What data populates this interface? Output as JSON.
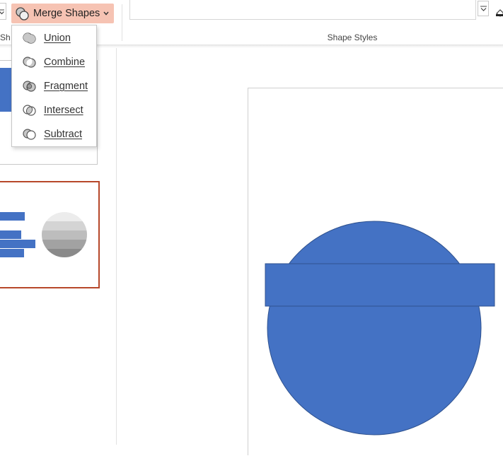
{
  "ribbon": {
    "merge_shapes": {
      "label": "Merge Shapes",
      "icon": "merge-shapes-icon"
    },
    "left_group_label": "Sha",
    "shape_styles_label": "Shape Styles",
    "style_swatches": [
      "#1f1f1f",
      "#4472c4",
      "#ed7d31",
      "#a5a5a5",
      "#ffc000",
      "#5b9bd5",
      "#70ad47"
    ]
  },
  "merge_menu": {
    "items": [
      {
        "label": "Union",
        "icon": "union-icon"
      },
      {
        "label": "Combine",
        "icon": "combine-icon"
      },
      {
        "label": "Fragment",
        "icon": "fragment-icon"
      },
      {
        "label": "Intersect",
        "icon": "intersect-icon"
      },
      {
        "label": "Subtract",
        "icon": "subtract-icon"
      }
    ]
  },
  "colors": {
    "shape_fill": "#4472c4",
    "shape_stroke": "#2f528f",
    "selected_thumb_border": "#b7472a",
    "merge_button_bg": "#f6c3b3"
  }
}
